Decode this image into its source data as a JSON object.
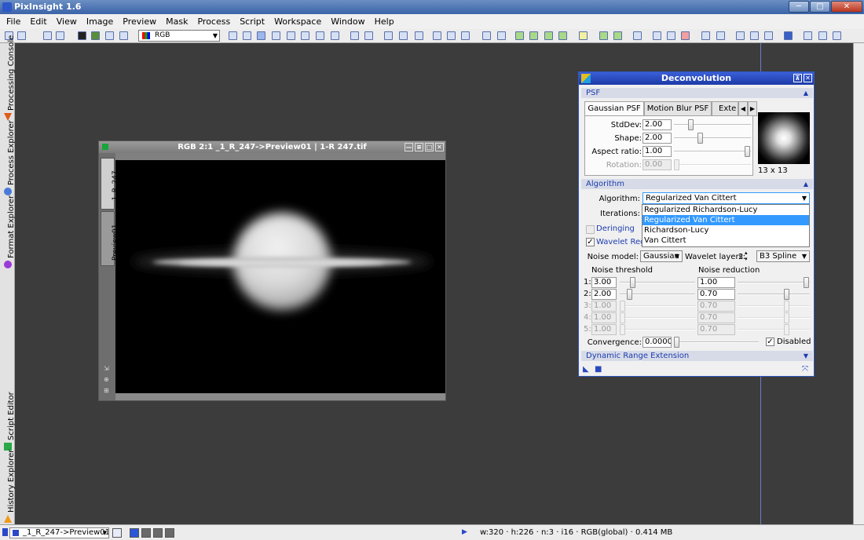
{
  "app": {
    "title": "PixInsight 1.6"
  },
  "window_controls": {
    "minimize": "─",
    "maximize": "□",
    "close": "✕"
  },
  "menu": [
    "File",
    "Edit",
    "View",
    "Image",
    "Preview",
    "Mask",
    "Process",
    "Script",
    "Workspace",
    "Window",
    "Help"
  ],
  "toolbar": {
    "channel_select": "RGB"
  },
  "sidebar": {
    "tabs": [
      "Processing Console",
      "Process Explorer",
      "Format Explorer",
      "Script Editor",
      "History Explorer"
    ]
  },
  "image_window": {
    "title": "RGB 2:1 _1_R_247->Preview01 | 1-R 247.tif",
    "tabs": [
      "_1_R_247",
      "Preview01"
    ],
    "controls": [
      "—",
      "≡",
      "□",
      "✕"
    ]
  },
  "deconvolution": {
    "title": "Deconvolution",
    "header_controls": [
      "⊼",
      "✕"
    ],
    "psf_section": "PSF",
    "psf_tabs": [
      "Gaussian PSF",
      "Motion Blur PSF",
      "Exte"
    ],
    "stddev_label": "StdDev:",
    "stddev_value": "2.00",
    "stddev_level": 0.2,
    "shape_label": "Shape:",
    "shape_value": "2.00",
    "shape_level": 0.33,
    "aspect_label": "Aspect ratio:",
    "aspect_value": "1.00",
    "aspect_level": 1.0,
    "rotation_label": "Rotation:",
    "rotation_value": "0.00",
    "rotation_level": 0.0,
    "psf_size": "13 x 13",
    "algorithm_section": "Algorithm",
    "algorithm_label": "Algorithm:",
    "algorithm_value": "Regularized Van Cittert",
    "algorithm_options": [
      "Regularized Richardson-Lucy",
      "Regularized Van Cittert",
      "Richardson-Lucy",
      "Van Cittert"
    ],
    "algorithm_selected_index": 1,
    "iterations_label": "Iterations:",
    "deringing_label": "Deringing",
    "wavelet_label": "Wavelet Regu",
    "noise_model_label": "Noise model:",
    "noise_model_value": "Gaussian",
    "wavelet_layers_label": "Wavelet layers:",
    "wavelet_layers_value": "2",
    "scaling_value": "B3 Spline",
    "noise_threshold_label": "Noise threshold",
    "noise_reduction_label": "Noise reduction",
    "layers": [
      {
        "index": "1:",
        "threshold": "3.00",
        "threshold_level": 0.15,
        "reduction": "1.00",
        "reduction_level": 1.0,
        "enabled": true
      },
      {
        "index": "2:",
        "threshold": "2.00",
        "threshold_level": 0.1,
        "reduction": "0.70",
        "reduction_level": 0.7,
        "enabled": true
      },
      {
        "index": "3:",
        "threshold": "1.00",
        "threshold_level": 0.0,
        "reduction": "0.70",
        "reduction_level": 0.7,
        "enabled": false
      },
      {
        "index": "4:",
        "threshold": "1.00",
        "threshold_level": 0.0,
        "reduction": "0.70",
        "reduction_level": 0.7,
        "enabled": false
      },
      {
        "index": "5:",
        "threshold": "1.00",
        "threshold_level": 0.0,
        "reduction": "0.70",
        "reduction_level": 0.7,
        "enabled": false
      }
    ],
    "convergence_label": "Convergence:",
    "convergence_value": "0.0000",
    "disabled_label": "Disabled",
    "dre_section": "Dynamic Range Extension"
  },
  "statusbar": {
    "view": "_1_R_247->Preview01",
    "info": "w:320 · h:226 · n:3 · i16 · RGB(global) · 0.414 MB"
  },
  "colors": {
    "title_blue": "#3a63a8",
    "section_text": "#1c3cae",
    "workspace": "#3c3c3c",
    "selection": "#3399ff"
  }
}
